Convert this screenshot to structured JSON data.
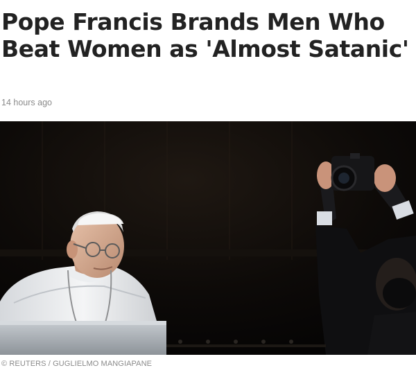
{
  "article": {
    "headline": "Pope Francis Brands Men Who Beat Women as 'Almost Satanic'",
    "timestamp": "14 hours ago",
    "photo_credit": "© REUTERS / GUGLIELMO MANGIAPANE"
  }
}
